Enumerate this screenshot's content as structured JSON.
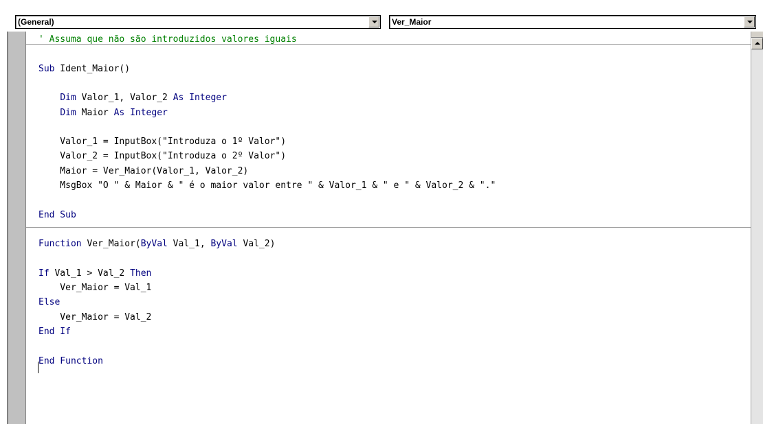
{
  "toolbar": {
    "object_combo": {
      "value": "(General)",
      "icon": "chevron-down-icon"
    },
    "procedure_combo": {
      "value": "Ver_Maior",
      "icon": "chevron-down-icon"
    }
  },
  "code": {
    "lines": [
      [
        {
          "t": "' Assuma que não são introduzidos valores iguais",
          "c": "cm"
        }
      ],
      [],
      [
        {
          "t": "Sub",
          "c": "kw"
        },
        {
          "t": " Ident_Maior()"
        }
      ],
      [],
      [
        {
          "t": "    "
        },
        {
          "t": "Dim",
          "c": "kw"
        },
        {
          "t": " Valor_1, Valor_2 "
        },
        {
          "t": "As",
          "c": "kw"
        },
        {
          "t": " "
        },
        {
          "t": "Integer",
          "c": "kw"
        }
      ],
      [
        {
          "t": "    "
        },
        {
          "t": "Dim",
          "c": "kw"
        },
        {
          "t": " Maior "
        },
        {
          "t": "As",
          "c": "kw"
        },
        {
          "t": " "
        },
        {
          "t": "Integer",
          "c": "kw"
        }
      ],
      [],
      [
        {
          "t": "    Valor_1 = InputBox(\"Introduza o 1º Valor\")"
        }
      ],
      [
        {
          "t": "    Valor_2 = InputBox(\"Introduza o 2º Valor\")"
        }
      ],
      [
        {
          "t": "    Maior = Ver_Maior(Valor_1, Valor_2)"
        }
      ],
      [
        {
          "t": "    MsgBox \"O \" & Maior & \" é o maior valor entre \" & Valor_1 & \" e \" & Valor_2 & \".\""
        }
      ],
      [],
      [
        {
          "t": "End Sub",
          "c": "kw"
        }
      ],
      [],
      [
        {
          "t": "Function",
          "c": "kw"
        },
        {
          "t": " Ver_Maior("
        },
        {
          "t": "ByVal",
          "c": "kw"
        },
        {
          "t": " Val_1, "
        },
        {
          "t": "ByVal",
          "c": "kw"
        },
        {
          "t": " Val_2)"
        }
      ],
      [],
      [
        {
          "t": "If",
          "c": "kw"
        },
        {
          "t": " Val_1 > Val_2 "
        },
        {
          "t": "Then",
          "c": "kw"
        }
      ],
      [
        {
          "t": "    Ver_Maior = Val_1"
        }
      ],
      [
        {
          "t": "Else",
          "c": "kw"
        }
      ],
      [
        {
          "t": "    Ver_Maior = Val_2"
        }
      ],
      [
        {
          "t": "End If",
          "c": "kw"
        }
      ],
      [],
      [
        {
          "t": "End Function",
          "c": "kw"
        }
      ]
    ]
  },
  "scrollbar": {
    "up_icon": "scroll-up-arrow-icon"
  },
  "colors": {
    "comment": "#008000",
    "keyword": "#00007f",
    "text": "#000000",
    "margin": "#c0c0c0"
  }
}
